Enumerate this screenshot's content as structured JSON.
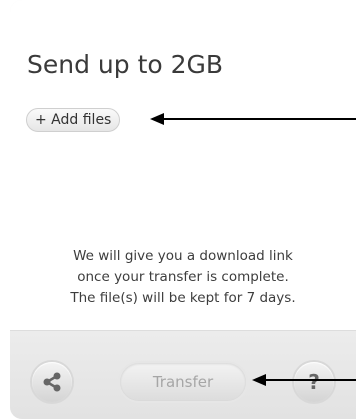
{
  "upload": {
    "headline": "Send up to 2GB",
    "add_files_label": "+ Add files"
  },
  "info": {
    "lines": [
      "We will give you a download link",
      "once your transfer is complete.",
      "The file(s) will be kept for 7 days."
    ]
  },
  "footer": {
    "share_icon": "share-icon",
    "transfer_label": "Transfer",
    "help_label": "?"
  },
  "colors": {
    "panel_background": "#f1f1f1",
    "text": "#3a3a3a",
    "disabled_text": "#a6a6a6",
    "annotation_arrow": "#000000"
  }
}
